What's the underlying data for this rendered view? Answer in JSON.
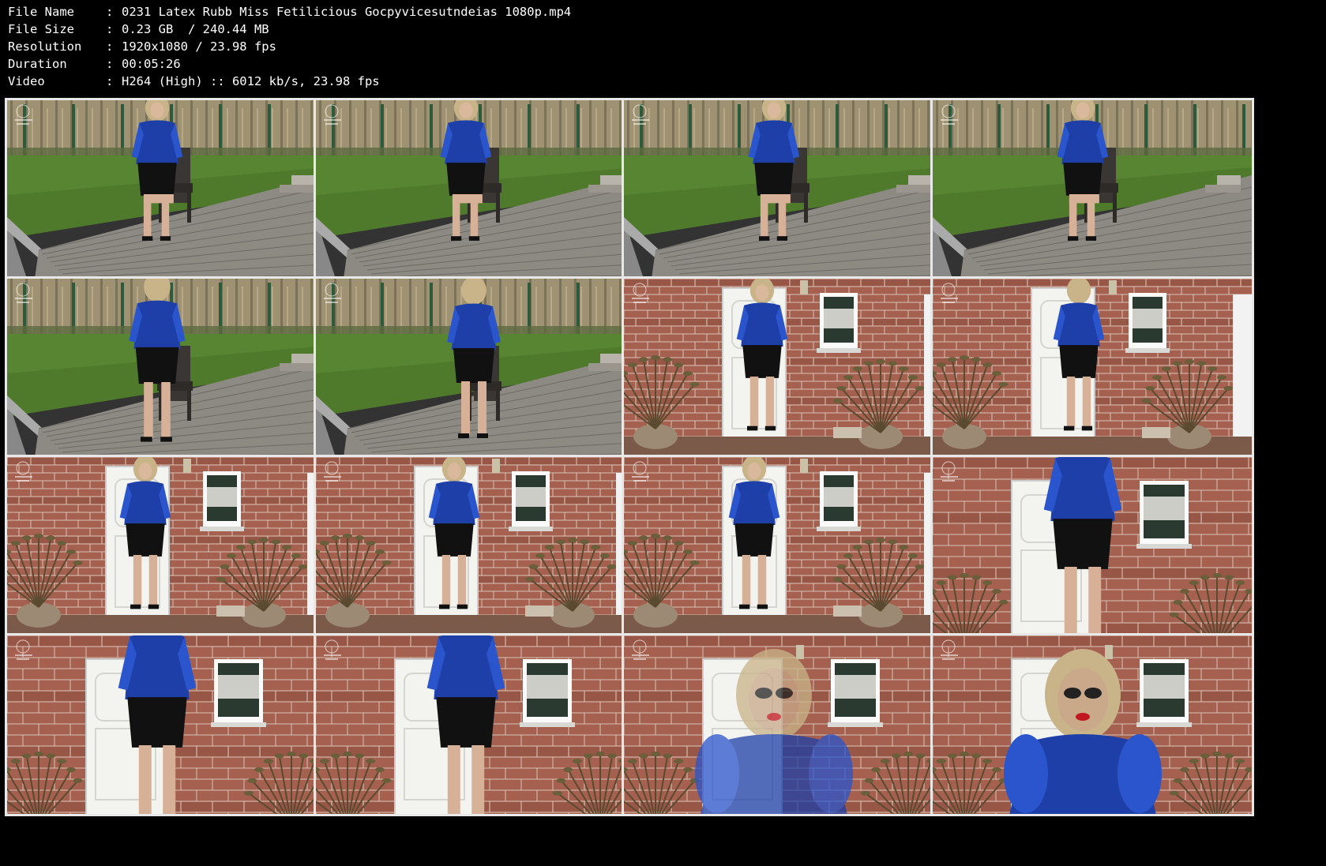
{
  "info": [
    {
      "label": "File Name",
      "value": "0231 Latex Rubb Miss Fetilicious Gocpyvicesutndeias 1080p.mp4"
    },
    {
      "label": "File Size",
      "value": "0.23 GB  / 240.44 MB"
    },
    {
      "label": "Resolution",
      "value": "1920x1080 / 23.98 fps"
    },
    {
      "label": "Duration",
      "value": "00:05:26"
    },
    {
      "label": "Video",
      "value": "H264 (High) :: 6012 kb/s, 23.98 fps"
    }
  ],
  "separator": ":",
  "thumbnails": [
    {
      "scene": "garden",
      "pose": "sit-1"
    },
    {
      "scene": "garden",
      "pose": "sit-2"
    },
    {
      "scene": "garden",
      "pose": "sit-3"
    },
    {
      "scene": "garden",
      "pose": "sit-4"
    },
    {
      "scene": "garden",
      "pose": "stand-back"
    },
    {
      "scene": "garden",
      "pose": "bend"
    },
    {
      "scene": "wall",
      "pose": "door-1"
    },
    {
      "scene": "wall",
      "pose": "door-back"
    },
    {
      "scene": "wall",
      "pose": "door-2"
    },
    {
      "scene": "wall",
      "pose": "door-3"
    },
    {
      "scene": "wall",
      "pose": "walk"
    },
    {
      "scene": "wall-close",
      "pose": "back-close"
    },
    {
      "scene": "wall-close",
      "pose": "back-close-2"
    },
    {
      "scene": "wall-close",
      "pose": "front-close"
    },
    {
      "scene": "wall-close",
      "pose": "face-fade"
    },
    {
      "scene": "wall-close",
      "pose": "face"
    }
  ],
  "colors": {
    "background": "#000000",
    "border": "#e8e8e8",
    "latex_blue": "#1e3fa8",
    "grass": "#4f7a2c",
    "brick": "#a5604f",
    "deck": "#8d8a84"
  }
}
